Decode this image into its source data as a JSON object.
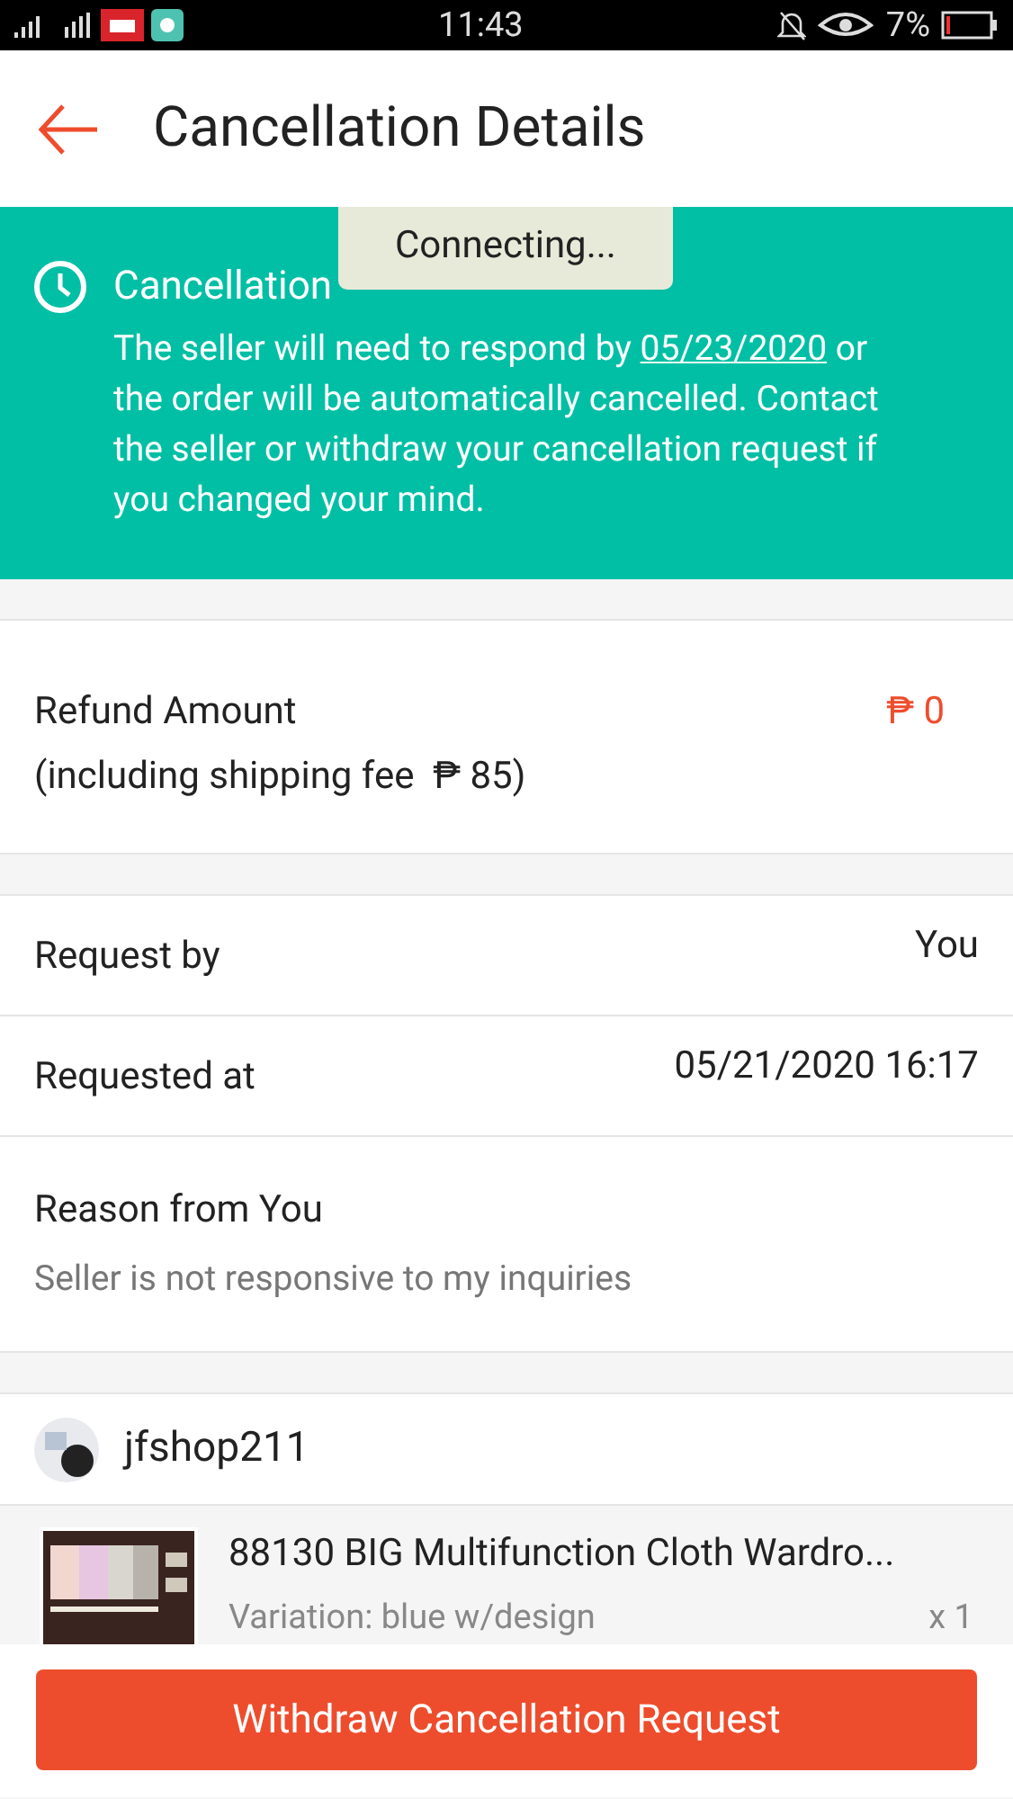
{
  "status_bar": {
    "time": "11:43",
    "battery": "7%"
  },
  "header": {
    "title": "Cancellation Details"
  },
  "toast": {
    "text": "Connecting..."
  },
  "banner": {
    "title": "Cancellation",
    "message_start": "The seller will need to respond by",
    "date": "05/23/2020",
    "message_end": "or the order will be automatically cancelled. Contact the seller or withdraw your cancellation request if you changed your mind."
  },
  "refund": {
    "label": "Refund Amount",
    "amount": "₱ 0",
    "note": "(including shipping fee  ₱ 85)"
  },
  "details": [
    {
      "label": "Request by",
      "value": "You"
    },
    {
      "label": "Requested at",
      "value": "05/21/2020 16:17"
    }
  ],
  "reason": {
    "label": "Reason from You",
    "value": "Seller is not responsive to my inquiries"
  },
  "shop": {
    "name": "jfshop211"
  },
  "product": {
    "name": "88130 BIG Multifunction Cloth Wardro...",
    "variation": "Variation: blue w/design",
    "quantity": "x 1"
  },
  "button": {
    "label": "Withdraw Cancellation Request"
  }
}
